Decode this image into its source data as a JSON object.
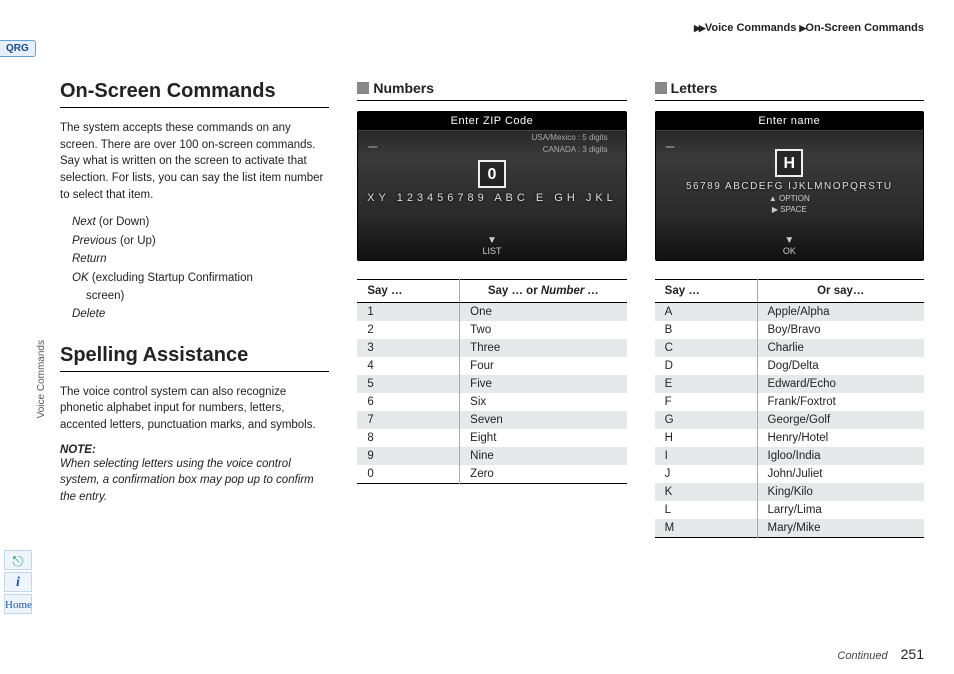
{
  "breadcrumb": {
    "a": "Voice Commands",
    "b": "On-Screen Commands"
  },
  "qrg": "QRG",
  "side_label": "Voice Commands",
  "side_icons": {
    "voice": "⎋",
    "info": "i",
    "home": "Home"
  },
  "left": {
    "h1": "On-Screen Commands",
    "p1": "The system accepts these commands on any screen. There are over 100 on-screen commands. Say what is written on the screen to activate that selection. For lists, you can say the list item number to select that item.",
    "cmds": {
      "next": "Next",
      "next_alt": " (or Down)",
      "prev": "Previous",
      "prev_alt": " (or Up)",
      "ret": "Return",
      "ok": "OK",
      "ok_alt": " (excluding Startup Confirmation",
      "ok_line2": "screen)",
      "del": "Delete"
    },
    "h2": "Spelling Assistance",
    "p2": "The voice control system can also recognize phonetic alphabet input for numbers, letters, accented letters, punctuation marks, and symbols.",
    "note_h": "NOTE:",
    "note_b": "When selecting letters using the voice control system, a confirmation box may pop up to confirm the entry."
  },
  "numbers": {
    "heading": "Numbers",
    "shot": {
      "title": "Enter ZIP Code",
      "sub1": "USA/Mexico : 5 digits",
      "sub2": "CANADA : 3 digits",
      "focus": "0",
      "ribbon": "XY 123456789 ABC E GH JKL",
      "bottom": "LIST"
    },
    "th1_a": "Say …",
    "th2_a": "Say … ",
    "th2_b": "or",
    "th2_c": " Number …",
    "rows": [
      {
        "a": "1",
        "b": "One"
      },
      {
        "a": "2",
        "b": "Two"
      },
      {
        "a": "3",
        "b": "Three"
      },
      {
        "a": "4",
        "b": "Four"
      },
      {
        "a": "5",
        "b": "Five"
      },
      {
        "a": "6",
        "b": "Six"
      },
      {
        "a": "7",
        "b": "Seven"
      },
      {
        "a": "8",
        "b": "Eight"
      },
      {
        "a": "9",
        "b": "Nine"
      },
      {
        "a": "0",
        "b": "Zero"
      }
    ]
  },
  "letters": {
    "heading": "Letters",
    "shot": {
      "title": "Enter name",
      "focus": "H",
      "ribbon": "56789 ABCDEFG IJKLMNOPQRSTU",
      "opt1": "▲ OPTION",
      "opt2": "▶ SPACE",
      "bottom": "OK"
    },
    "th1": "Say …",
    "th2": "Or say…",
    "rows": [
      {
        "a": "A",
        "b": "Apple/Alpha"
      },
      {
        "a": "B",
        "b": "Boy/Bravo"
      },
      {
        "a": "C",
        "b": "Charlie"
      },
      {
        "a": "D",
        "b": "Dog/Delta"
      },
      {
        "a": "E",
        "b": "Edward/Echo"
      },
      {
        "a": "F",
        "b": "Frank/Foxtrot"
      },
      {
        "a": "G",
        "b": "George/Golf"
      },
      {
        "a": "H",
        "b": "Henry/Hotel"
      },
      {
        "a": "I",
        "b": "Igloo/India"
      },
      {
        "a": "J",
        "b": "John/Juliet"
      },
      {
        "a": "K",
        "b": "King/Kilo"
      },
      {
        "a": "L",
        "b": "Larry/Lima"
      },
      {
        "a": "M",
        "b": "Mary/Mike"
      }
    ]
  },
  "footer": {
    "continued": "Continued",
    "page": "251"
  }
}
